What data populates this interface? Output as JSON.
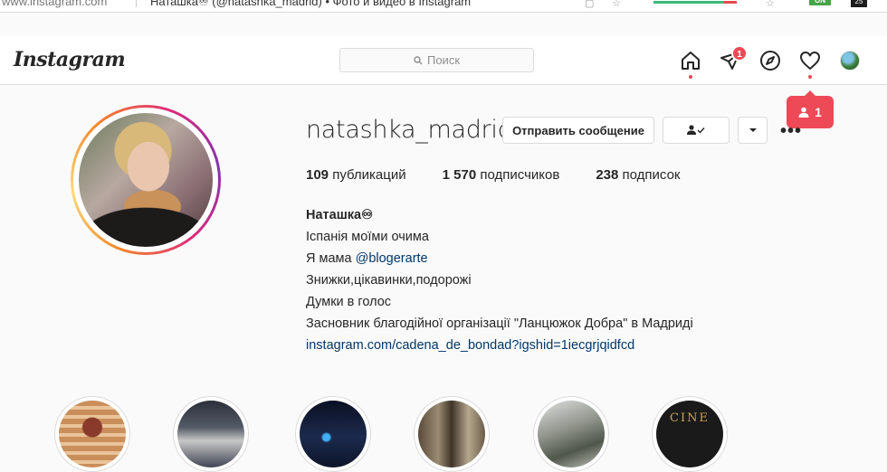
{
  "browser": {
    "url": "www.instagram.com",
    "tab_title": "Наташка♾ (@natashka_madrid) • Фото и видео в Instagram",
    "ext_badge": "ON",
    "ext_badge2": "25"
  },
  "nav": {
    "logo": "Instagram",
    "search_placeholder": "Поиск",
    "dm_badge": "1",
    "notification_count": "1"
  },
  "profile": {
    "username": "natashka_madrid",
    "message_button": "Отправить сообщение",
    "stats": {
      "posts_count": "109",
      "posts_label": "публикаций",
      "followers_count": "1 570",
      "followers_label": "подписчиков",
      "following_count": "238",
      "following_label": "подписок"
    },
    "bio": {
      "name": "Наташка♾",
      "line1": "Іспанія моїми очима",
      "line2_prefix": "Я мама ",
      "line2_mention": "@blogerarte",
      "line2_suffix": " ",
      "line3": "Знижки,цікавинки,подорожі",
      "line4": "Думки в голос",
      "line5": "Засновник благодійної організації \"Ланцюжок Добра\" в Мадриді",
      "link": "instagram.com/cadena_de_bondad?igshid=1iecgrjqidfcd"
    }
  },
  "highlights": [
    {
      "icon": "pancakes-image"
    },
    {
      "icon": "people-image"
    },
    {
      "icon": "night-city-image"
    },
    {
      "icon": "forest-image"
    },
    {
      "icon": "nature-image"
    },
    {
      "icon": "cine-logo",
      "text": "CINE"
    }
  ],
  "colors": {
    "accent_red": "#ed4956",
    "link_blue": "#00376b",
    "ext_green": "#46a546"
  }
}
